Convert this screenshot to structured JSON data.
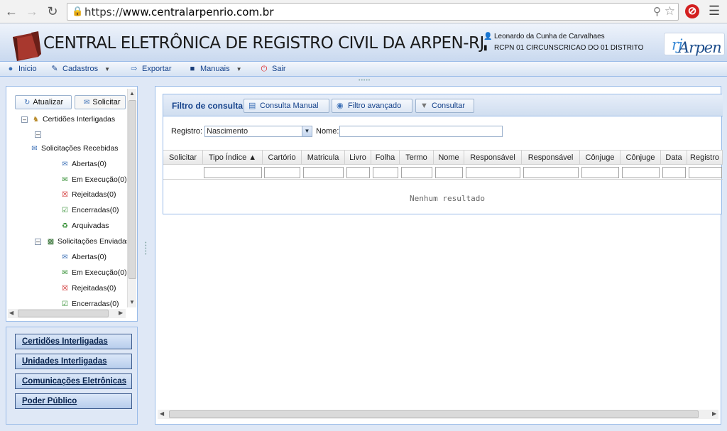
{
  "browser": {
    "url_prefix": "https://",
    "url_domain": "www.centralarpenrio.com.br"
  },
  "header": {
    "title": "CENTRAL ELETRÔNICA DE REGISTRO CIVIL DA ARPEN-RJ",
    "user_name": "Leonardo da Cunha de Carvalhaes",
    "user_office": "RCPN 01 CIRCUNSCRICAO DO 01 DISTRITO",
    "brand_main": "Arpen",
    "brand_suffix": "rj"
  },
  "toolbar": {
    "inicio": "Inicio",
    "cadastros": "Cadastros",
    "exportar": "Exportar",
    "manuais": "Manuais",
    "sair": "Sair"
  },
  "west": {
    "atualizar": "Atualizar",
    "solicitar": "Solicitar",
    "tree": {
      "root": "Certidões Interligadas",
      "recebidas": "Solicitações Recebidas",
      "recebidas_items": [
        "Abertas(0)",
        "Em Execução(0)",
        "Rejeitadas(0)",
        "Encerradas(0)",
        "Arquivadas"
      ],
      "enviadas": "Solicitações Enviadas",
      "enviadas_items": [
        "Abertas(0)",
        "Em Execução(0)",
        "Rejeitadas(0)",
        "Encerradas(0)"
      ]
    },
    "links": [
      "Certidões Interligadas",
      "Unidades Interligadas",
      "Comunicações Eletrônicas",
      "Poder Público"
    ]
  },
  "filter": {
    "title": "Filtro de consulta",
    "btn_manual": "Consulta Manual",
    "btn_avancado": "Filtro avançado",
    "btn_consultar": "Consultar",
    "registro_label": "Registro:",
    "registro_value": "Nascimento",
    "nome_label": "Nome:",
    "nome_value": ""
  },
  "grid": {
    "columns": [
      "Solicitar",
      "Tipo Índice ▲",
      "Cartório",
      "Matricula",
      "Livro",
      "Folha",
      "Termo",
      "Nome",
      "Responsável",
      "Responsável",
      "Cônjuge",
      "Cônjuge",
      "Data",
      "Registro"
    ],
    "empty_message": "Nenhum resultado"
  },
  "colors": {
    "panel_border": "#99bbe8",
    "header_text": "#15428b",
    "background": "#dfe8f6"
  }
}
